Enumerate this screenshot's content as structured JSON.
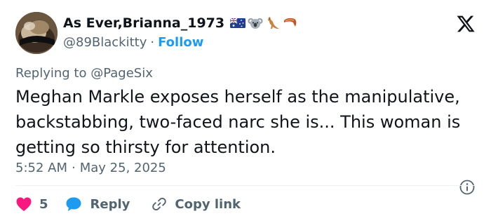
{
  "tweet": {
    "display_name": "As Ever,Brianna_1973",
    "handle": "@89Blackitty",
    "separator": "·",
    "follow_label": "Follow",
    "name_emojis": [
      "australia-flag-icon",
      "koala-icon",
      "kangaroo-icon",
      "boomerang-icon"
    ],
    "replying_prefix": "Replying to",
    "replying_to": "@PageSix",
    "text": "Meghan Markle exposes herself as the manipulative, backstabbing, two-faced narc she is... This woman is getting so thirsty for attention.",
    "time": "5:52 AM",
    "date": "May 25, 2025"
  },
  "actions": {
    "like_count": "5",
    "reply_label": "Reply",
    "copy_link_label": "Copy link"
  },
  "colors": {
    "text": "#0f1419",
    "secondary": "#536471",
    "link": "#1d9bf0",
    "like": "#f91880",
    "reply": "#1d9bf0"
  }
}
